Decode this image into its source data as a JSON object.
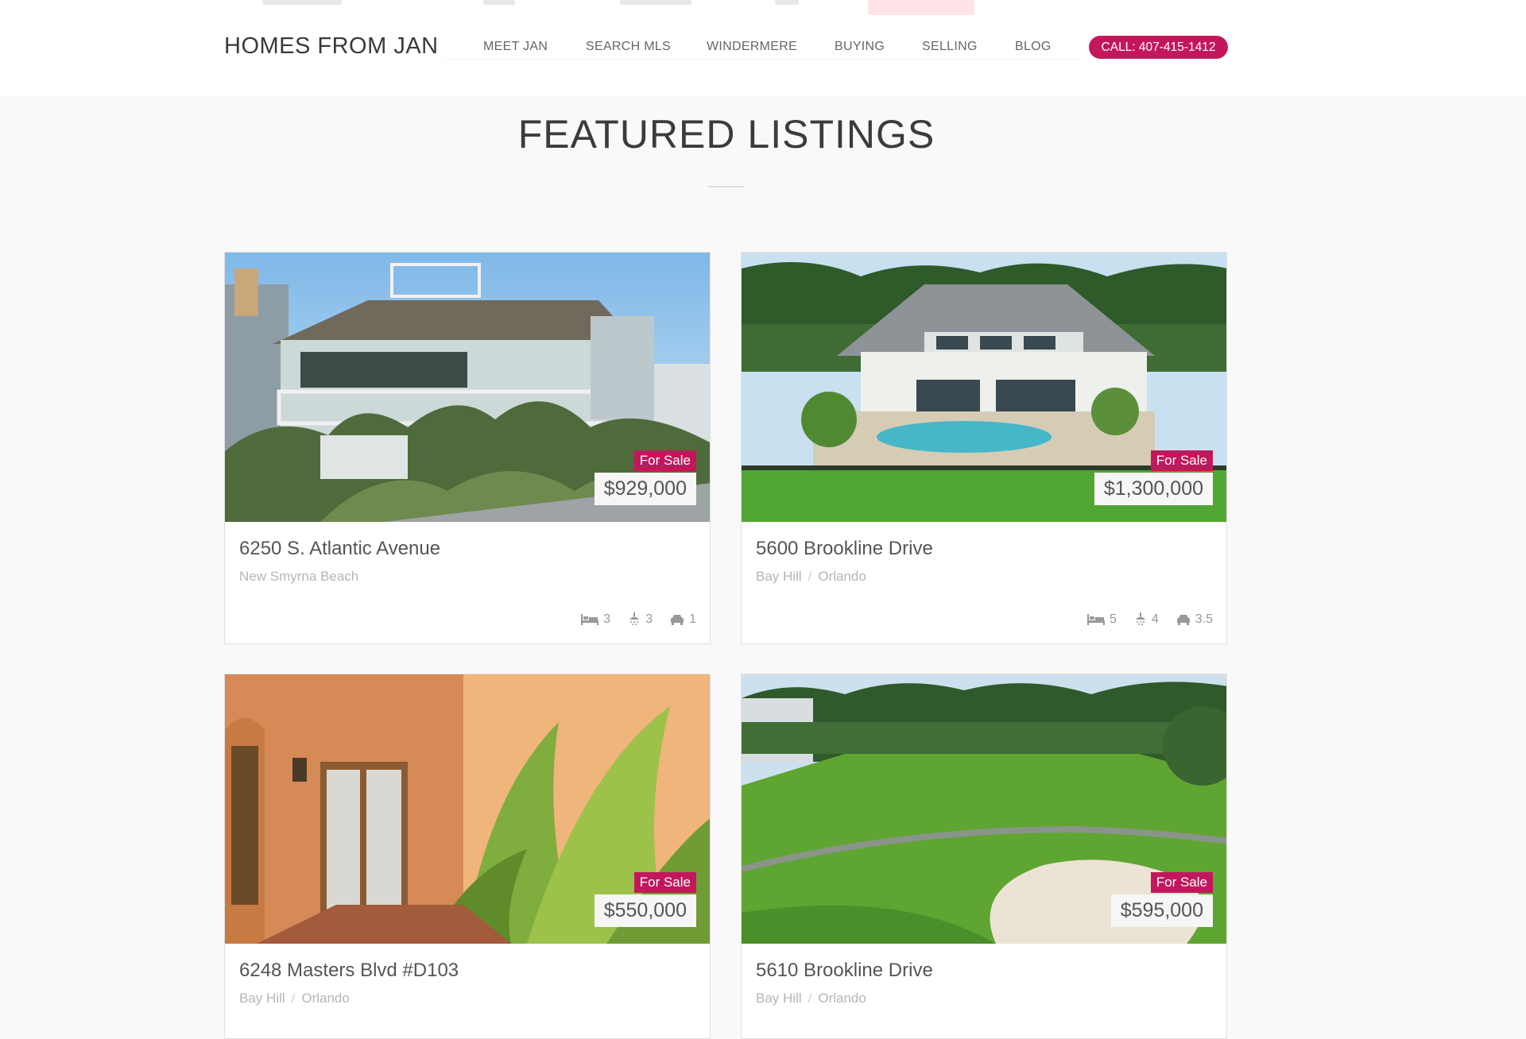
{
  "brand": {
    "logo": "HOMES FROM JAN",
    "accent": "#c2185b"
  },
  "nav": {
    "items": [
      "MEET JAN",
      "SEARCH MLS",
      "WINDERMERE",
      "BUYING",
      "SELLING",
      "BLOG"
    ],
    "call_label": "CALL: 407-415-1412"
  },
  "section": {
    "title": "FEATURED LISTINGS"
  },
  "listings": [
    {
      "status": "For Sale",
      "price": "$929,000",
      "address": "6250 S. Atlantic Avenue",
      "locations": [
        "New Smyrna Beach"
      ],
      "beds": "3",
      "baths": "3",
      "garage": "1",
      "photo_icon": "beach-house-photo"
    },
    {
      "status": "For Sale",
      "price": "$1,300,000",
      "address": "5600 Brookline Drive",
      "locations": [
        "Bay Hill",
        "Orlando"
      ],
      "beds": "5",
      "baths": "4",
      "garage": "3.5",
      "photo_icon": "pool-house-photo"
    },
    {
      "status": "For Sale",
      "price": "$550,000",
      "address": "6248 Masters Blvd #D103",
      "locations": [
        "Bay Hill",
        "Orlando"
      ],
      "photo_icon": "courtyard-entrance-photo"
    },
    {
      "status": "For Sale",
      "price": "$595,000",
      "address": "5610 Brookline Drive",
      "locations": [
        "Bay Hill",
        "Orlando"
      ],
      "photo_icon": "golf-course-photo"
    }
  ]
}
